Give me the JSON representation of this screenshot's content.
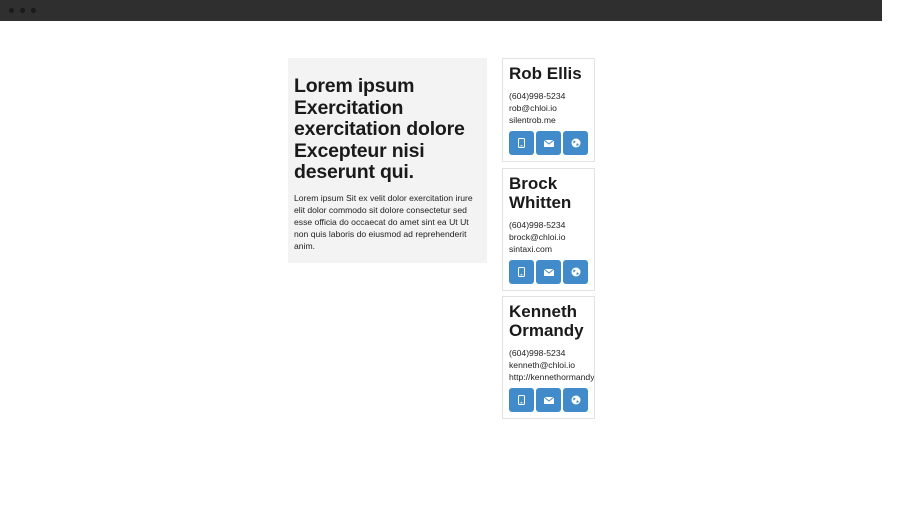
{
  "hero": {
    "heading": "Lorem ipsum Exercitation exercitation dolore Excepteur nisi deserunt qui.",
    "body": "Lorem ipsum Sit ex velit dolor exercitation irure elit dolor commodo sit dolore consectetur sed esse officia do occaecat do amet sint ea Ut Ut non quis laboris do eiusmod ad reprehenderit anim."
  },
  "contacts": [
    {
      "name": "Rob Ellis",
      "phone": "(604)998-5234",
      "email": "rob@chloi.io",
      "website": "silentrob.me"
    },
    {
      "name": "Brock Whitten",
      "phone": "(604)998-5234",
      "email": "brock@chloi.io",
      "website": "sintaxi.com"
    },
    {
      "name": "Kenneth Ormandy",
      "phone": "(604)998-5234",
      "email": "kenneth@chloi.io",
      "website": "http://kennethormandy.com"
    }
  ],
  "buttons": {
    "phone_icon": "mobile-phone-icon",
    "email_icon": "envelope-icon",
    "web_icon": "globe-icon"
  },
  "colors": {
    "button": "#428bca",
    "hero_bg": "#f3f3f3",
    "titlebar": "#2f2f2f"
  }
}
